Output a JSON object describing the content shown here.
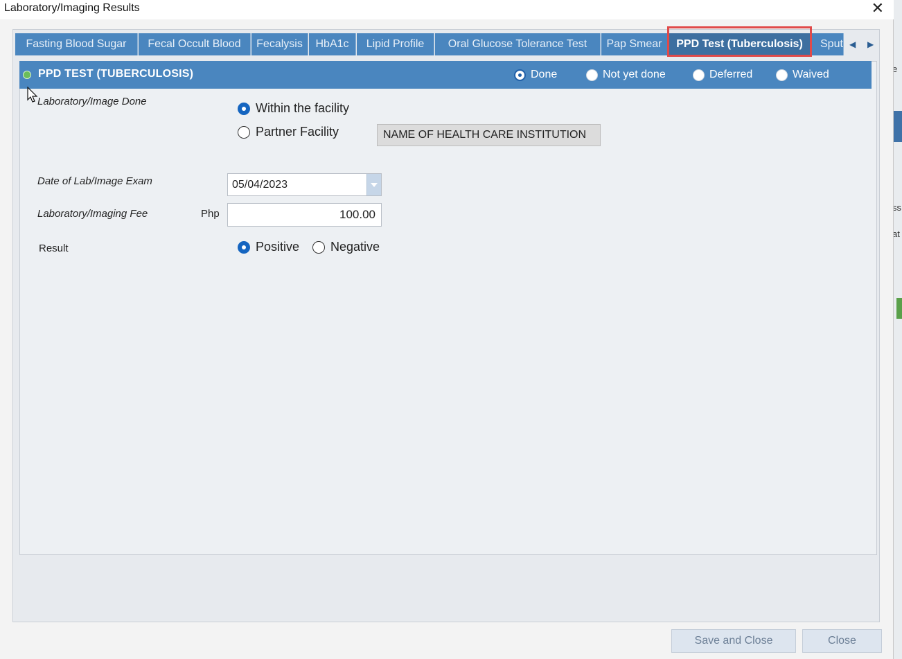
{
  "window": {
    "title": "Laboratory/Imaging Results",
    "close_glyph": "✕"
  },
  "tabs": [
    {
      "label": "Fasting Blood Sugar",
      "active": false
    },
    {
      "label": "Fecal Occult Blood",
      "active": false
    },
    {
      "label": "Fecalysis",
      "active": false
    },
    {
      "label": "HbA1c",
      "active": false
    },
    {
      "label": "Lipid Profile",
      "active": false
    },
    {
      "label": "Oral Glucose Tolerance Test",
      "active": false
    },
    {
      "label": "Pap Smear",
      "active": false
    },
    {
      "label": "PPD Test (Tuberculosis)",
      "active": true
    },
    {
      "label": "Sput",
      "active": false
    }
  ],
  "tab_nav": {
    "prev_glyph": "◀",
    "next_glyph": "▶"
  },
  "panel": {
    "title": "PPD TEST (TUBERCULOSIS)",
    "status_options": [
      {
        "label": "Done",
        "selected": true
      },
      {
        "label": "Not yet done",
        "selected": false
      },
      {
        "label": "Deferred",
        "selected": false
      },
      {
        "label": "Waived",
        "selected": false
      }
    ]
  },
  "form": {
    "lab_done_label": "Laboratory/Image Done",
    "location_options": [
      {
        "label": "Within the facility",
        "selected": true
      },
      {
        "label": "Partner Facility",
        "selected": false
      }
    ],
    "institution_placeholder": "NAME OF HEALTH CARE INSTITUTION",
    "date_label": "Date of Lab/Image Exam",
    "date_value": "05/04/2023",
    "fee_label": "Laboratory/Imaging Fee",
    "fee_currency": "Php",
    "fee_value": "100.00",
    "result_label": "Result",
    "result_options": [
      {
        "label": "Positive",
        "selected": true
      },
      {
        "label": "Negative",
        "selected": false
      }
    ]
  },
  "footer": {
    "save_label": "Save and Close",
    "close_label": "Close"
  },
  "background_strip": {
    "fragments": [
      "e",
      "ss",
      "at"
    ]
  },
  "colors": {
    "accent": "#4a86bf",
    "highlight": "#e04a4a",
    "radio_selected": "#1565c0"
  }
}
